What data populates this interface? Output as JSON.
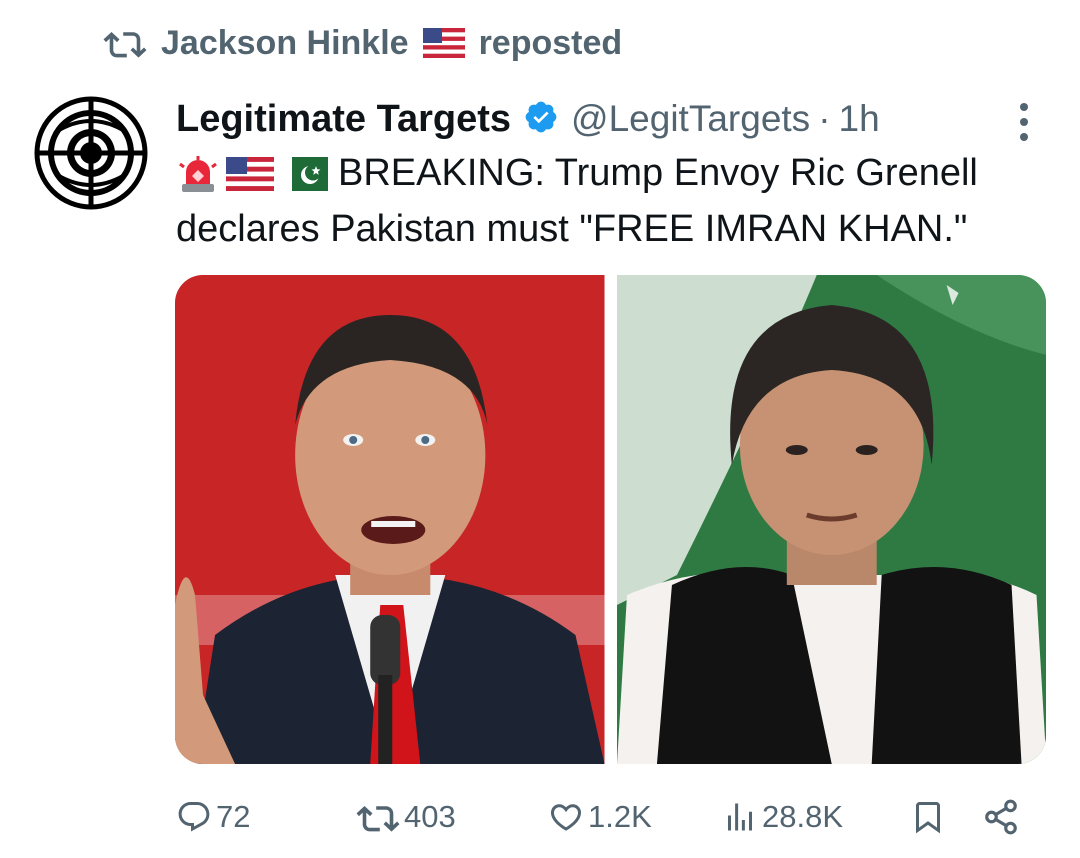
{
  "repost": {
    "icon": "repost-icon",
    "user": "Jackson Hinkle",
    "flag": "us-flag-emoji",
    "suffix": "reposted"
  },
  "post": {
    "author": {
      "display_name": "Legitimate Targets",
      "handle": "@LegitTargets",
      "separator": "·",
      "time": "1h",
      "verified_color": "#1d9bf0",
      "avatar_icon": "crosshair-globe-logo"
    },
    "text": {
      "emojis": [
        "rotating-light-emoji",
        "us-flag-emoji",
        "pakistan-flag-emoji"
      ],
      "line1": "BREAKING: Trump Envoy Ric Grenell",
      "line2": "declares Pakistan must \"FREE IMRAN KHAN.\""
    },
    "media": [
      {
        "name": "ric-grenell-photo",
        "background": "#cf2a2a"
      },
      {
        "name": "imran-khan-photo",
        "background": "#2f7a43"
      }
    ],
    "stats": {
      "replies": "72",
      "reposts": "403",
      "likes": "1.2K",
      "views": "28.8K"
    }
  },
  "colors": {
    "text": "#0f1419",
    "secondary": "#536471",
    "accent": "#1d9bf0"
  }
}
